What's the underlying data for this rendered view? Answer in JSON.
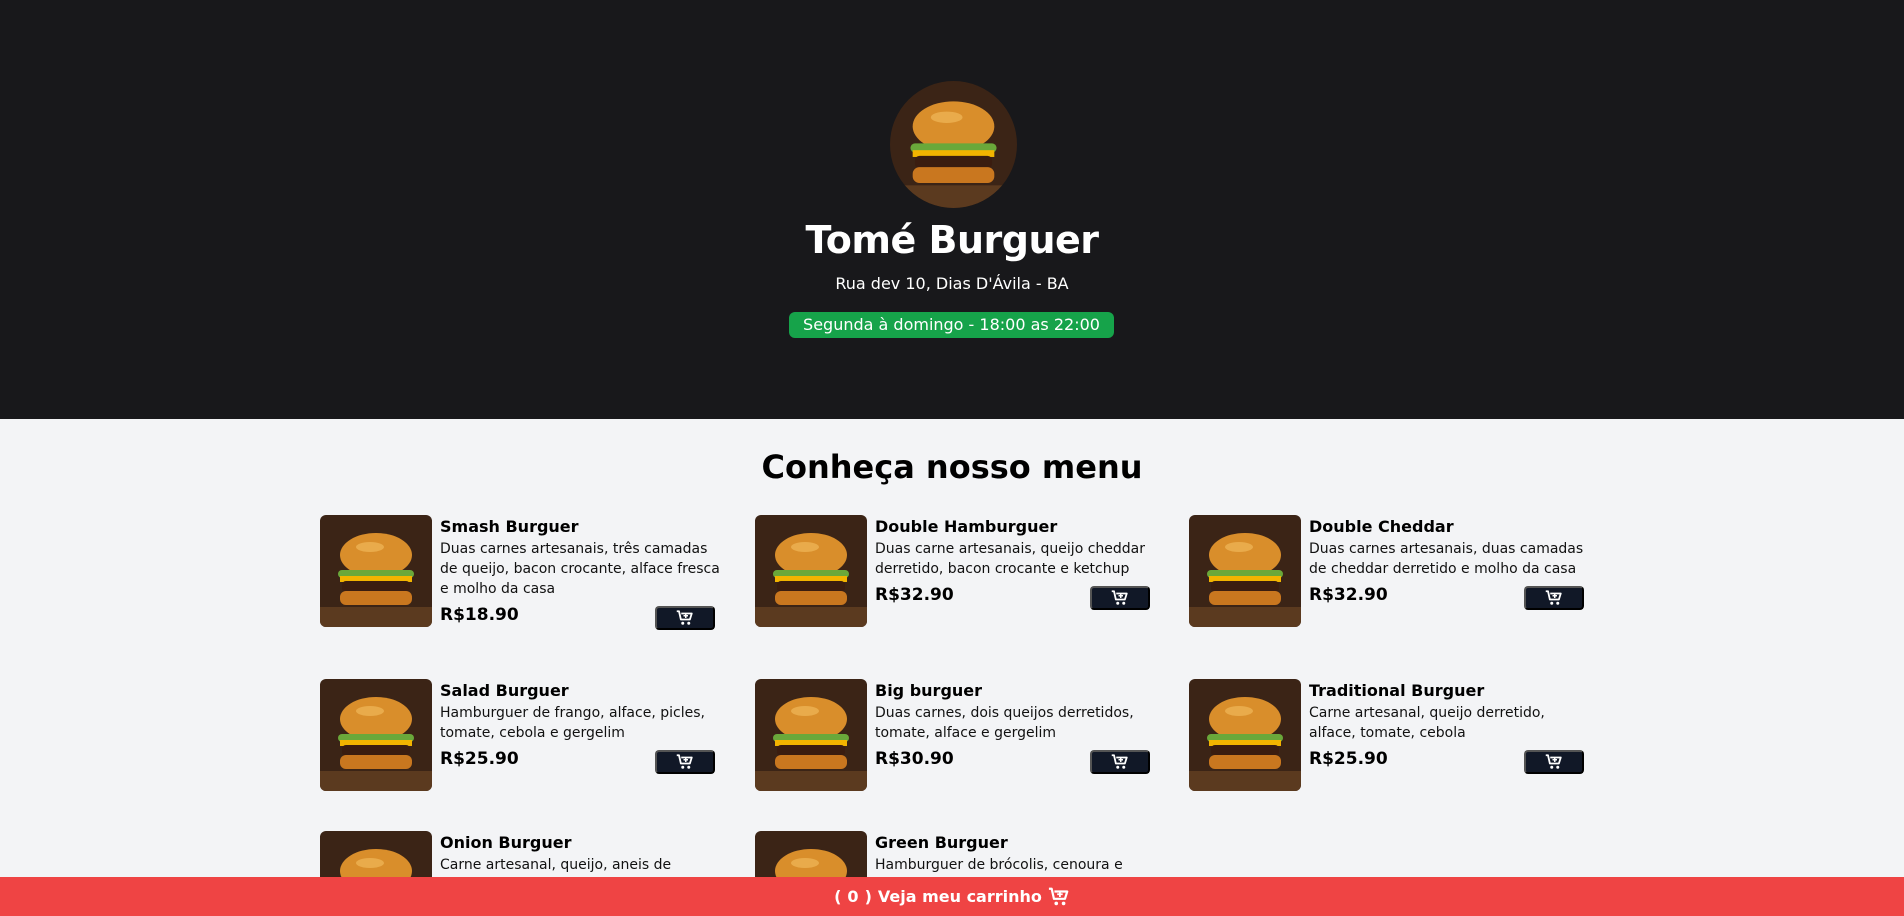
{
  "header": {
    "title": "Tomé Burguer",
    "address": "Rua dev 10, Dias D'Ávila - BA",
    "hours": "Segunda à domingo - 18:00 as 22:00",
    "logo_icon": "burger-logo-image"
  },
  "menu": {
    "title": "Conheça nosso menu",
    "items": [
      {
        "name": "Smash Burguer",
        "description": "Duas carnes artesanais, três camadas de queijo, bacon crocante, alface fresca e molho da casa",
        "price": "R$18.90"
      },
      {
        "name": "Double Hamburguer",
        "description": "Duas carne artesanais, queijo cheddar derretido, bacon crocante e ketchup",
        "price": "R$32.90"
      },
      {
        "name": "Double Cheddar",
        "description": "Duas carnes artesanais, duas camadas de cheddar derretido e molho da casa",
        "price": "R$32.90"
      },
      {
        "name": "Salad Burguer",
        "description": "Hamburguer de frango, alface, picles, tomate, cebola e gergelim",
        "price": "R$25.90"
      },
      {
        "name": "Big burguer",
        "description": "Duas carnes, dois queijos derretidos, tomate, alface e gergelim",
        "price": "R$30.90"
      },
      {
        "name": "Traditional Burguer",
        "description": "Carne artesanal, queijo derretido, alface, tomate, cebola",
        "price": "R$25.90"
      },
      {
        "name": "Onion Burguer",
        "description": "Carne artesanal, queijo, aneis de",
        "price": ""
      },
      {
        "name": "Green Burguer",
        "description": "Hamburguer de brócolis, cenoura e",
        "price": ""
      }
    ]
  },
  "footer": {
    "cart_open": "(",
    "cart_count": "0",
    "cart_close": ")",
    "cart_label": "Veja meu carrinho",
    "cart_icon": "cart-icon"
  },
  "colors": {
    "hero_bg": "#18181b",
    "hours_badge": "#16a34a",
    "cart_button": "#111827",
    "footer_bg": "#ef4444"
  }
}
